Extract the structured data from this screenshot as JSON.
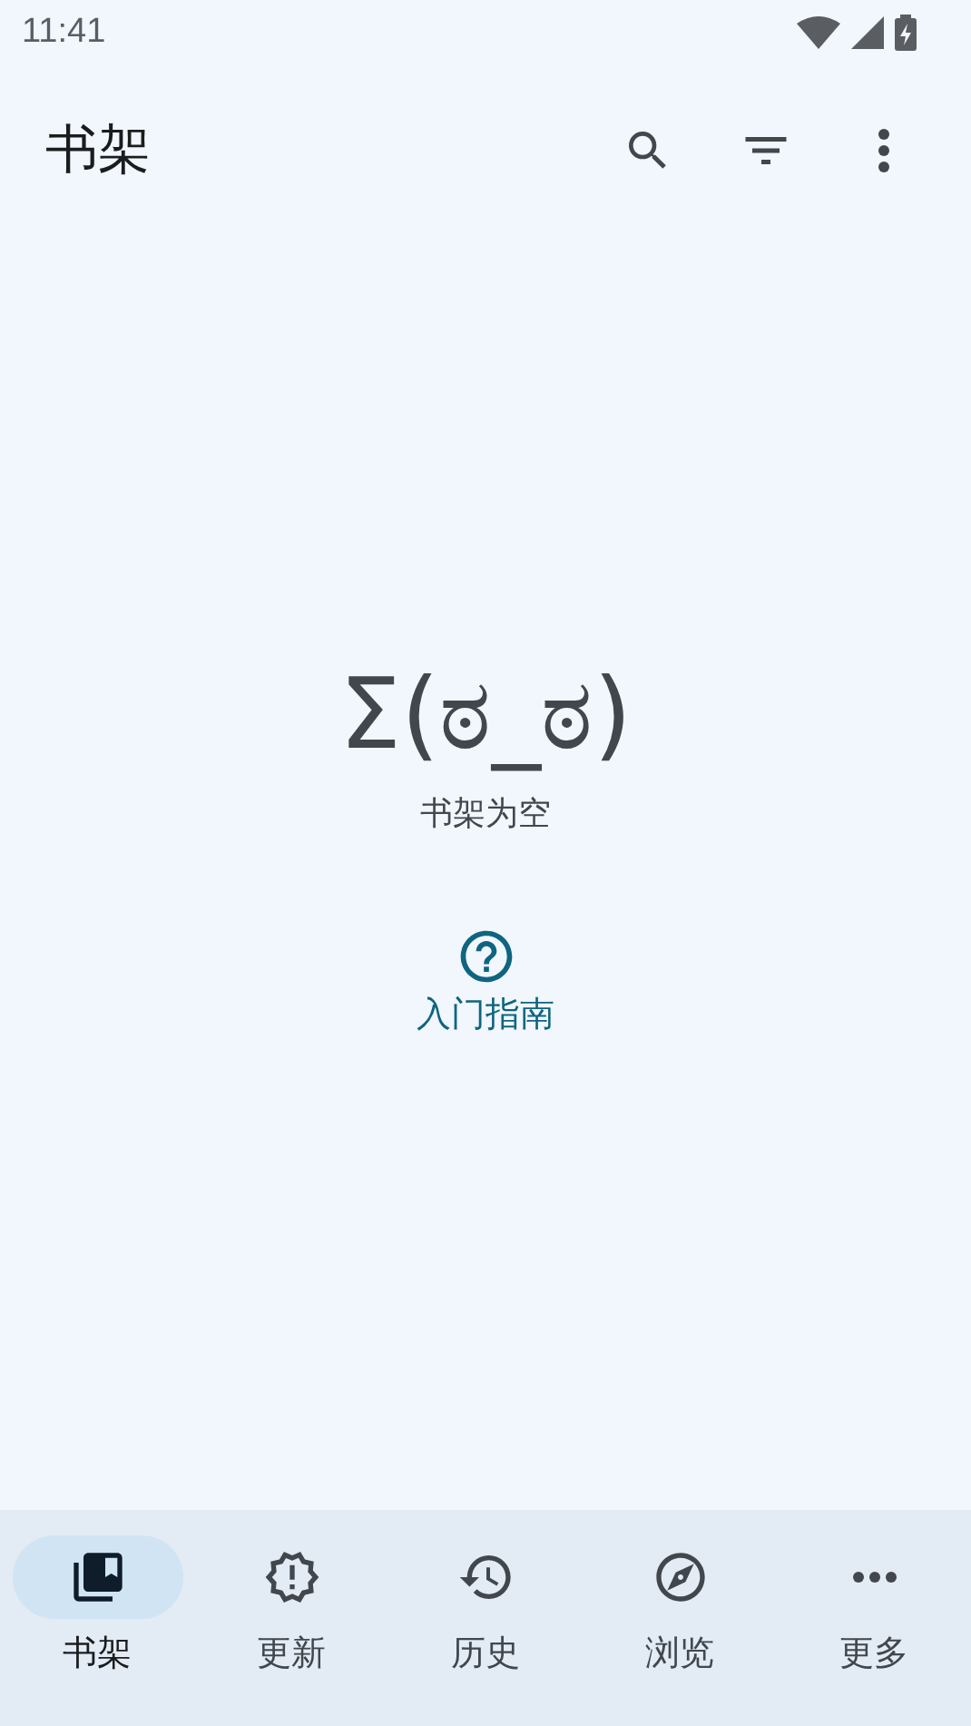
{
  "status_bar": {
    "time": "11:41"
  },
  "app_bar": {
    "title": "书架"
  },
  "empty_state": {
    "face": "Σ(ಠ_ಠ)",
    "message": "书架为空",
    "guide_link": "入门指南"
  },
  "nav": [
    {
      "label": "书架",
      "kind": "library",
      "selected": true
    },
    {
      "label": "更新",
      "kind": "updates",
      "selected": false
    },
    {
      "label": "历史",
      "kind": "history",
      "selected": false
    },
    {
      "label": "浏览",
      "kind": "browse",
      "selected": false
    },
    {
      "label": "更多",
      "kind": "more",
      "selected": false
    }
  ]
}
